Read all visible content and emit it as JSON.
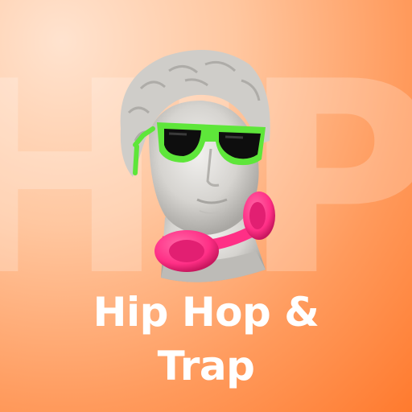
{
  "background": {
    "word": "HIP",
    "gradient_colors": [
      "#ffe3cf",
      "#ffc7a0",
      "#ff9a5c",
      "#ff7a2e"
    ]
  },
  "artwork": {
    "subject": "statue-head-icon",
    "accessories": [
      "sunglasses-icon",
      "headphones-icon"
    ],
    "colors": {
      "stone": "#d8d6d2",
      "glasses_frame": "#5ee63a",
      "lens": "#0e0e0e",
      "headphones": "#ff2f86"
    }
  },
  "title": {
    "line1": "Hip Hop &",
    "line2": "Trap"
  }
}
